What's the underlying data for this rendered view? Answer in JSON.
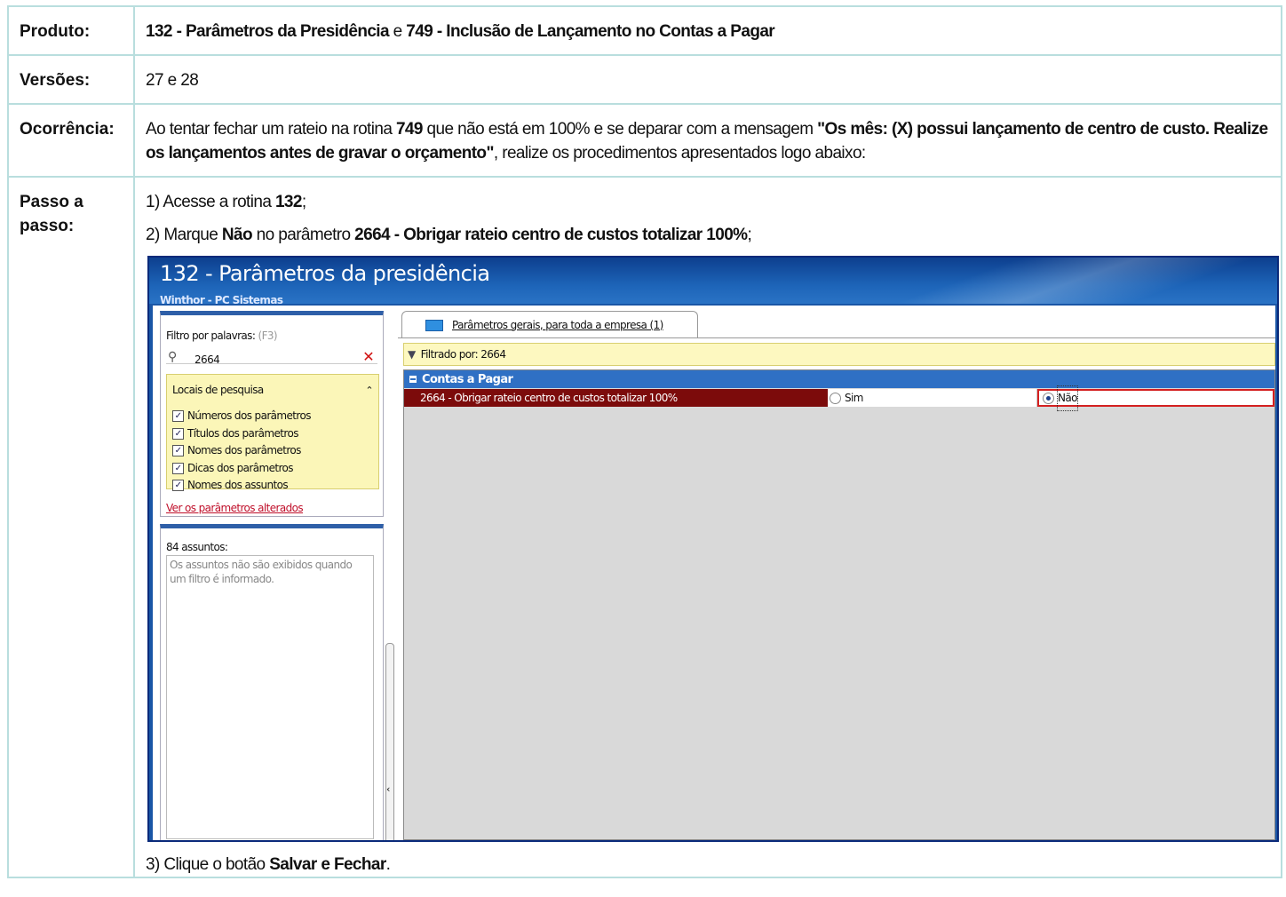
{
  "rows": {
    "produto": {
      "label": "Produto:",
      "p1": "132 - Parâmetros da Presidência",
      "p2": " e ",
      "p3": "749 - Inclusão de Lançamento no Contas a Pagar"
    },
    "versoes": {
      "label": "Versões:",
      "value": "27 e 28"
    },
    "ocorrencia": {
      "label": "Ocorrência:",
      "p1": "Ao tentar fechar um rateio na rotina ",
      "p2": "749",
      "p3": " que não está em 100% e se deparar com a mensagem ",
      "p4": "\"Os mês: (X) possui lançamento de centro de custo. Realize os lançamentos antes de gravar o orçamento\"",
      "p5": ", realize os procedimentos apresentados logo abaixo:"
    },
    "passo": {
      "label": "Passo a passo:",
      "s1a": "1) Acesse a rotina ",
      "s1b": "132",
      "s1c": ";",
      "s2a": "2) Marque ",
      "s2b": "Não",
      "s2c": " no parâmetro ",
      "s2d": "2664 - Obrigar rateio centro de custos totalizar 100%",
      "s2e": ";",
      "s3a": "3) Clique o botão ",
      "s3b": "Salvar e Fechar",
      "s3c": "."
    }
  },
  "screenshot": {
    "title": "132 - Parâmetros da presidência",
    "subtitle": "Winthor - PC Sistemas",
    "filter_label": "Filtro por palavras:",
    "filter_hint": "(F3)",
    "filter_value": "2664",
    "locais_title": "Locais de pesquisa",
    "locais": [
      "Números dos parâmetros",
      "Títulos dos parâmetros",
      "Nomes dos parâmetros",
      "Dicas dos parâmetros",
      "Nomes dos assuntos"
    ],
    "link": "Ver os parâmetros alterados",
    "assuntos_label": "84 assuntos:",
    "assuntos_msg": "Os assuntos não são exibidos quando um filtro é informado.",
    "tab_label": "Parâmetros gerais, para toda a empresa  (1)",
    "filtered_by": "Filtrado por: 2664",
    "group": "Contas a Pagar",
    "param_name": "2664 - Obrigar rateio centro de custos totalizar 100%",
    "opt_sim": "Sim",
    "opt_nao": "Não"
  }
}
